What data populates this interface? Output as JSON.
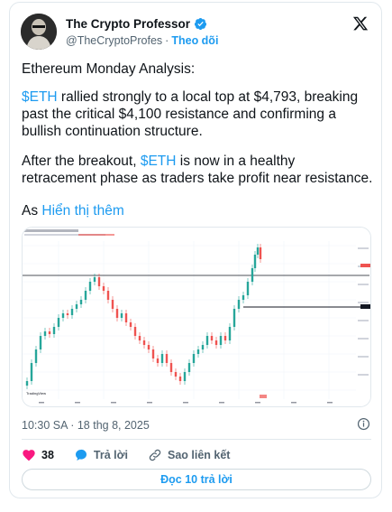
{
  "author": {
    "name": "The Crypto Professor",
    "handle": "@TheCryptoProfes",
    "follow_label": "Theo dõi",
    "separator": "·"
  },
  "tweet": {
    "line1": "Ethereum Monday Analysis:",
    "p2_cashtag": "$ETH",
    "p2_rest": " rallied strongly to a local top at $4,793, breaking past the critical $4,100 resistance and confirming a bullish continuation structure.",
    "p3_pre": "After the breakout, ",
    "p3_cashtag": "$ETH",
    "p3_rest": " is now in a healthy retracement phase as traders take profit near resistance.",
    "p4_pre": "As ",
    "show_more": "Hiển thị thêm"
  },
  "chart_image": {
    "watermark": "TradingView",
    "description_icon": "candlestick-chart"
  },
  "meta": {
    "time": "10:30 SA · 18 thg 8, 2025"
  },
  "actions": {
    "likes": "38",
    "reply_label": "Trả lời",
    "copy_link_label": "Sao liên kết"
  },
  "read_replies": "Đọc 10 trả lời",
  "colors": {
    "accent": "#1d9bf0",
    "like": "#f91880",
    "up_candle": "#26a69a",
    "down_candle": "#ef5350"
  }
}
